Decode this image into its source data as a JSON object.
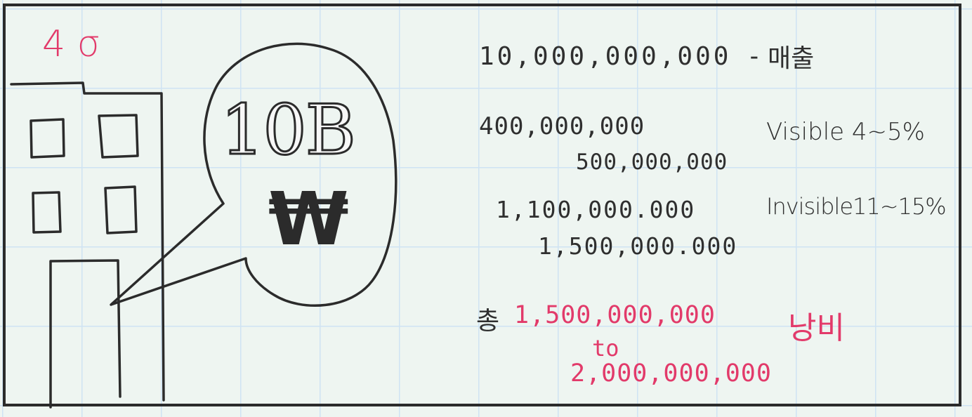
{
  "floor_label": "4 σ",
  "bubble": {
    "amount": "10B",
    "currency_symbol": "₩"
  },
  "revenue": {
    "value": "10,000,000,000",
    "separator": "-",
    "label": "매출"
  },
  "visible": {
    "low": "400,000,000",
    "high": "500,000,000",
    "label": "Visible 4~5%"
  },
  "invisible": {
    "low": "1,100,000.000",
    "high": "1,500,000.000",
    "label": "Invisible11~15%"
  },
  "total": {
    "prefix": "총",
    "low": "1,500,000,000",
    "to": "to",
    "high": "2,000,000,000",
    "tag": "낭비"
  },
  "colors": {
    "ink": "#2f2f2f",
    "accent_pink": "#e23a6a",
    "paper": "#eef5f1",
    "grid": "#cfe3f3"
  }
}
